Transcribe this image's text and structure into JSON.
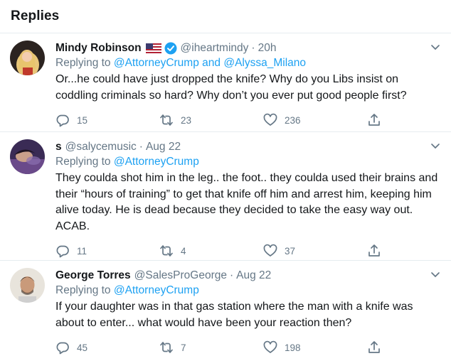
{
  "header": {
    "title": "Replies"
  },
  "replying_prefix": "Replying to",
  "tweets": [
    {
      "name": "Mindy Robinson",
      "handle": "@iheartmindy",
      "time": "20h",
      "replying": [
        "@AttorneyCrump",
        "@Alyssa_Milano"
      ],
      "replying_joiner": "and",
      "text": "Or...he could have just dropped the knife? Why do you Libs insist on coddling criminals so hard? Why don’t you ever put good people first?",
      "replies": "15",
      "retweets": "23",
      "likes": "236"
    },
    {
      "name": "s",
      "handle": "@salycemusic",
      "time": "Aug 22",
      "replying": [
        "@AttorneyCrump"
      ],
      "text": "They coulda shot him in the leg.. the foot.. they coulda used their brains and their “hours of training” to get that knife off him and arrest him, keeping him alive today. He is dead because they decided to take the easy way out. ACAB.",
      "replies": "11",
      "retweets": "4",
      "likes": "37"
    },
    {
      "name": "George Torres",
      "handle": "@SalesProGeorge",
      "time": "Aug 22",
      "replying": [
        "@AttorneyCrump"
      ],
      "text": "If your daughter was in that gas station where the man with a knife was about to enter... what would have been your reaction then?",
      "replies": "45",
      "retweets": "7",
      "likes": "198"
    }
  ],
  "icons": {
    "reply": "reply-icon",
    "retweet": "retweet-icon",
    "like": "heart-icon",
    "share": "share-icon",
    "caret": "chevron-down-icon",
    "verified": "verified-badge-icon",
    "flag": "us-flag-icon"
  },
  "colors": {
    "link": "#1da1f2",
    "secondary": "#657786",
    "text": "#14171a",
    "divider": "#e6ecf0"
  }
}
